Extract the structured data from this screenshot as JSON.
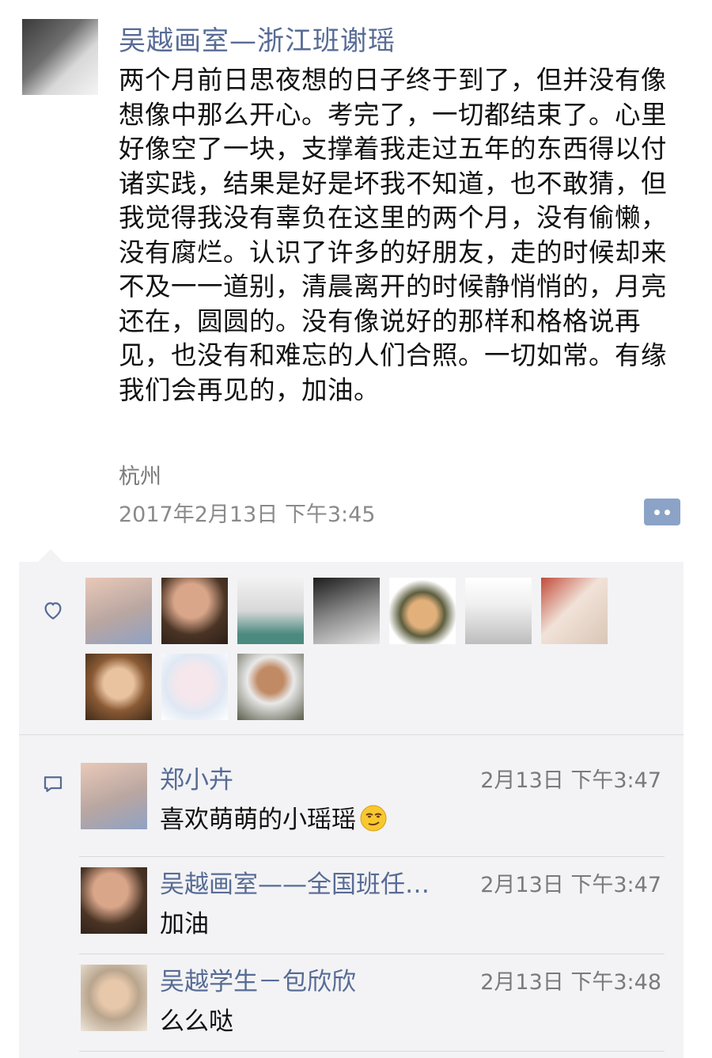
{
  "post": {
    "author": "吴越画室—浙江班谢瑶",
    "text": "两个月前日思夜想的日子终于到了，但并没有像想像中那么开心。考完了，一切都结束了。心里好像空了一块，支撑着我走过五年的东西得以付诸实践，结果是好是坏我不知道，也不敢猜，但我觉得我没有辜负在这里的两个月，没有偷懒，没有腐烂。认识了许多的好朋友，走的时候却来不及一一道别，清晨离开的时候静悄悄的，月亮还在，圆圆的。没有像说好的那样和格格说再见，也没有和难忘的人们合照。一切如常。有缘我们会再见的，加油。",
    "location": "杭州",
    "timestamp": "2017年2月13日  下午3:45",
    "more_icon": "more-comment-icon"
  },
  "likes": {
    "icon": "heart-icon",
    "count_shown": 10
  },
  "comments": [
    {
      "name": "郑小卉",
      "time": "2月13日  下午3:47",
      "text": "喜欢萌萌的小瑶瑶",
      "emoji": "smirk-emoji-icon"
    },
    {
      "name": "吴越画室——全国班任…",
      "time": "2月13日  下午3:47",
      "text": "加油"
    },
    {
      "name": "吴越学生－包欣欣",
      "time": "2月13日  下午3:48",
      "text": "么么哒"
    }
  ],
  "colors": {
    "link_blue": "#576b95",
    "feedback_bg": "#f3f3f5",
    "more_button": "#8ba3c7"
  }
}
